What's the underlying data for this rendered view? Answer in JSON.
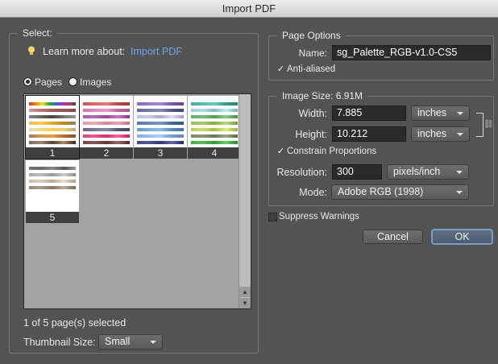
{
  "window": {
    "title": "Import PDF"
  },
  "select_group": {
    "legend": "Select:",
    "learn_prefix": "Learn more about:",
    "learn_link": "Import PDF",
    "radio_pages": "Pages",
    "radio_images": "Images",
    "selected_mode": "pages",
    "thumbnails": [
      {
        "page": "1",
        "selected": true
      },
      {
        "page": "2",
        "selected": false
      },
      {
        "page": "3",
        "selected": false
      },
      {
        "page": "4",
        "selected": false
      },
      {
        "page": "5",
        "selected": false
      }
    ],
    "status": "1 of 5 page(s) selected",
    "thumbnail_size_label": "Thumbnail Size:",
    "thumbnail_size_value": "Small"
  },
  "page_options": {
    "legend": "Page Options",
    "name_label": "Name:",
    "name_value": "sg_Palette_RGB-v1.0-CS5",
    "anti_aliased_label": "Anti-aliased",
    "anti_aliased": true
  },
  "image_size": {
    "legend": "Image Size: 6.91M",
    "width_label": "Width:",
    "width_value": "7.885",
    "width_unit": "inches",
    "height_label": "Height:",
    "height_value": "10.212",
    "height_unit": "inches",
    "constrain_label": "Constrain Proportions",
    "constrain": true,
    "resolution_label": "Resolution:",
    "resolution_value": "300",
    "resolution_unit": "pixels/inch",
    "mode_label": "Mode:",
    "mode_value": "Adobe RGB (1998)"
  },
  "suppress_warnings_label": "Suppress Warnings",
  "suppress_warnings": false,
  "buttons": {
    "cancel": "Cancel",
    "ok": "OK"
  },
  "icons": {
    "tip": "lightbulb-icon",
    "link": "chain-link-icon"
  },
  "colors": {
    "link_blue": "#6aa6e8",
    "bulb": "#f5d76e"
  }
}
